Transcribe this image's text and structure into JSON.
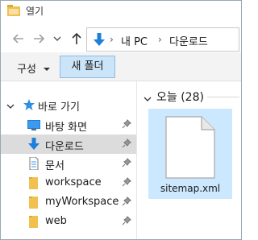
{
  "window": {
    "title": "열기"
  },
  "navigation": {
    "back_icon": "arrow-left-icon",
    "forward_icon": "arrow-right-icon",
    "recent_icon": "chevron-down-icon",
    "up_icon": "arrow-up-icon"
  },
  "address_bar": {
    "separator": "›",
    "crumbs": [
      "내 PC",
      "다운로드"
    ]
  },
  "ribbon": {
    "organize_label": "구성",
    "new_folder_label": "새 폴더"
  },
  "sidebar": {
    "quick_access_label": "바로 가기",
    "items": [
      {
        "label": "바탕 화면",
        "icon": "desktop-icon",
        "selected": false
      },
      {
        "label": "다운로드",
        "icon": "download-icon",
        "selected": true
      },
      {
        "label": "문서",
        "icon": "document-icon",
        "selected": false
      },
      {
        "label": "workspace",
        "icon": "folder-icon",
        "selected": false
      },
      {
        "label": "myWorkspace",
        "icon": "folder-icon",
        "selected": false
      },
      {
        "label": "web",
        "icon": "folder-icon",
        "selected": false
      }
    ]
  },
  "content": {
    "group_label": "오늘 (28)",
    "files": [
      {
        "name": "sitemap.xml",
        "icon": "file-icon",
        "selected": true
      }
    ]
  },
  "colors": {
    "accent": "#0078d7",
    "selection": "#cce8ff",
    "sidebar_selected": "#dcdcdc",
    "folder": "#f1c14f"
  }
}
